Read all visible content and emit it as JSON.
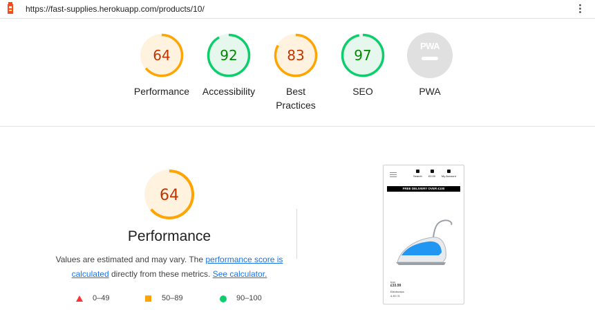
{
  "url": "https://fast-supplies.herokuapp.com/products/10/",
  "colors": {
    "fail": "#ff3333",
    "average": "#ffa400",
    "pass": "#0cce6b",
    "average_text": "#c33300",
    "pass_text": "#008800",
    "link": "#1a73e8"
  },
  "categories": [
    {
      "id": "performance",
      "label": "Performance",
      "score": "64",
      "status": "average"
    },
    {
      "id": "accessibility",
      "label": "Accessibility",
      "score": "92",
      "status": "pass"
    },
    {
      "id": "best-practices",
      "label": "Best Practices",
      "score": "83",
      "status": "average"
    },
    {
      "id": "seo",
      "label": "SEO",
      "score": "97",
      "status": "pass"
    },
    {
      "id": "pwa",
      "label": "PWA",
      "badge_text": "PWA"
    }
  ],
  "performance": {
    "score": "64",
    "title": "Performance",
    "desc_prefix": "Values are estimated and may vary. The ",
    "link1": "performance score is calculated",
    "desc_middle": " directly from these metrics. ",
    "link2": "See calculator."
  },
  "legend": [
    {
      "shape": "triangle",
      "range": "0–49"
    },
    {
      "shape": "square",
      "range": "50–89"
    },
    {
      "shape": "circle",
      "range": "90–100"
    }
  ],
  "thumbnail": {
    "nav": [
      "Search",
      "£0.00",
      "My Account"
    ],
    "banner": "FREE DELIVERY OVER £100",
    "product_name": "Iron",
    "price": "£33.99",
    "category": "Electronics",
    "rating": "4.40 / 5"
  }
}
